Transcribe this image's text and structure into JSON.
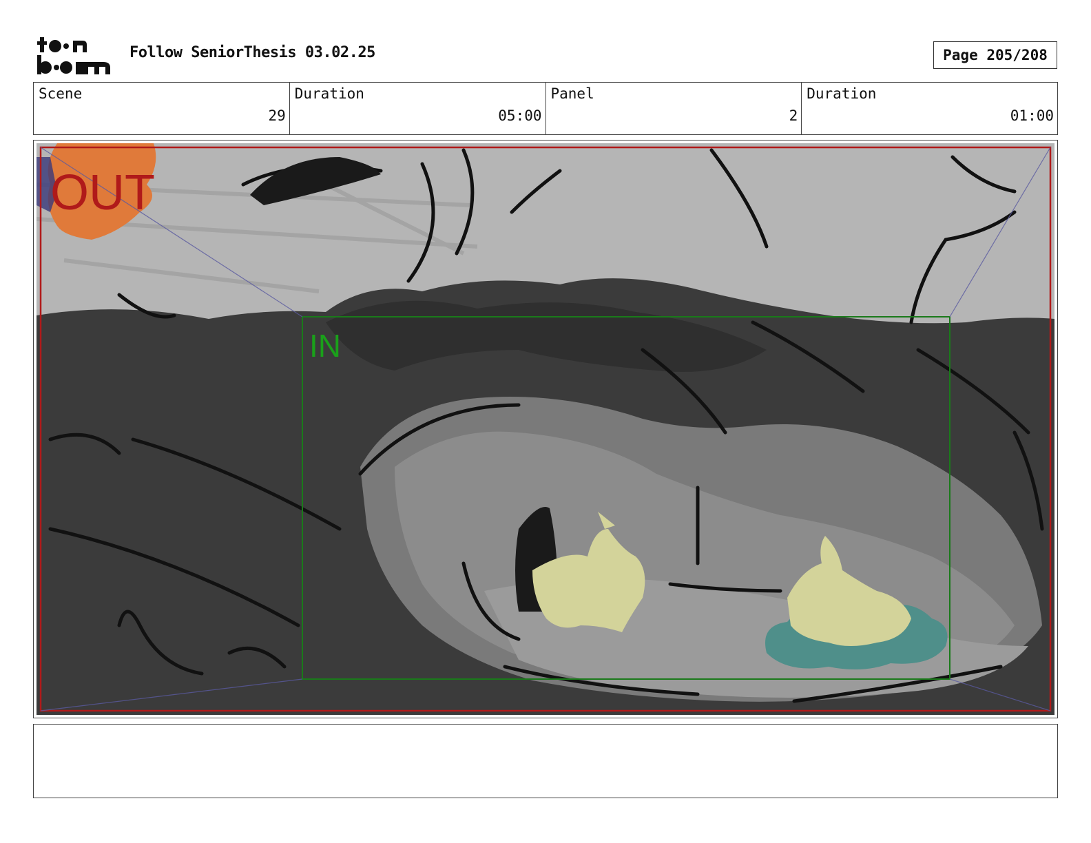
{
  "header": {
    "doc_title": "Follow SeniorThesis 03.02.25",
    "page_label": "Page 205/208"
  },
  "info": {
    "scene_label": "Scene",
    "scene_value": "29",
    "scene_duration_label": "Duration",
    "scene_duration_value": "05:00",
    "panel_label": "Panel",
    "panel_value": "2",
    "panel_duration_label": "Duration",
    "panel_duration_value": "01:00"
  },
  "panel": {
    "out_label": "OUT",
    "in_label": "IN",
    "colors": {
      "out_frame": "#b01a1a",
      "in_frame": "#1a7a1a",
      "sky": "#b5b5b5",
      "ground": "#3b3b3b",
      "creature": "#d3d39a",
      "bush": "#4f8f8a",
      "orange_sketch": "#e07a3a"
    }
  },
  "notes": {
    "text": ""
  }
}
